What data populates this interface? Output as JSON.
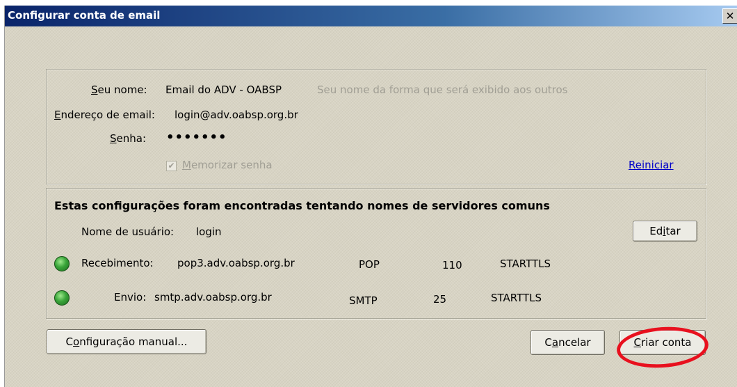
{
  "window": {
    "title": "Configurar conta de email",
    "close_glyph": "✕"
  },
  "account": {
    "name_label": {
      "pre": "",
      "key": "S",
      "post": "eu nome:"
    },
    "name_value": "Email do ADV - OABSP",
    "name_hint": "Seu nome da forma que será exibido aos outros",
    "email_label": {
      "pre": "",
      "key": "E",
      "post": "ndereço de email:"
    },
    "email_value": "login@adv.oabsp.org.br",
    "password_label": {
      "pre": "",
      "key": "S",
      "post": "enha:"
    },
    "password_value": "•••••••",
    "remember": {
      "pre": "",
      "key": "M",
      "post": "emorizar senha",
      "checked": true,
      "disabled": true
    },
    "reset_link": "Reiniciar"
  },
  "servers": {
    "heading": "Estas configurações foram encontradas tentando nomes de servidores comuns",
    "username_label": "Nome de usuário:",
    "username_value": "login",
    "edit_button": {
      "pre": "Ed",
      "key": "i",
      "post": "tar"
    },
    "incoming": {
      "label": "Recebimento:",
      "host": "pop3.adv.oabsp.org.br",
      "protocol": "POP",
      "port": "110",
      "security": "STARTTLS",
      "status_color": "#3aa53a"
    },
    "outgoing": {
      "label": "Envio:",
      "host": "smtp.adv.oabsp.org.br",
      "protocol": "SMTP",
      "port": "25",
      "security": "STARTTLS",
      "status_color": "#3aa53a"
    }
  },
  "footer": {
    "manual_button": {
      "pre": "C",
      "key": "o",
      "post": "nfiguração manual..."
    },
    "cancel_button": {
      "pre": "C",
      "key": "a",
      "post": "ncelar"
    },
    "create_button": {
      "pre": "",
      "key": "C",
      "post": "riar conta"
    },
    "highlight_color": "#e8101e"
  }
}
